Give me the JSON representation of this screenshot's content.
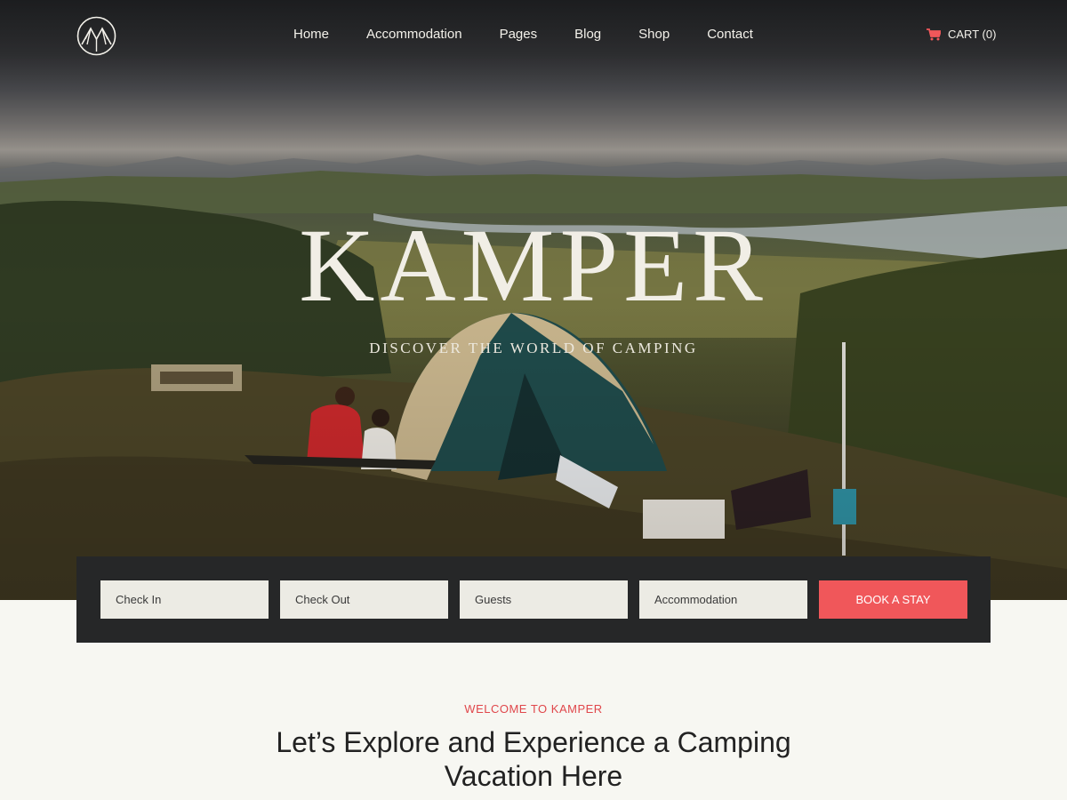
{
  "nav": {
    "logo_icon": "mountain-tent-logo-icon",
    "items": [
      {
        "label": "Home"
      },
      {
        "label": "Accommodation"
      },
      {
        "label": "Pages"
      },
      {
        "label": "Blog"
      },
      {
        "label": "Shop"
      },
      {
        "label": "Contact"
      }
    ],
    "cart": {
      "icon": "cart-icon",
      "label": "CART (0)",
      "icon_color": "#f0575a"
    }
  },
  "hero": {
    "title": "KAMPER",
    "subtitle": "DISCOVER THE WORLD OF CAMPING"
  },
  "booking": {
    "check_in": "Check In",
    "check_out": "Check Out",
    "guests": "Guests",
    "accommodation": "Accommodation",
    "button": "BOOK A STAY",
    "button_color": "#f0575a",
    "bar_color": "#262728"
  },
  "welcome": {
    "kicker": "WELCOME TO KAMPER",
    "title": "Let’s Explore and Experience a Camping Vacation Here",
    "kicker_color": "#e0474b"
  }
}
